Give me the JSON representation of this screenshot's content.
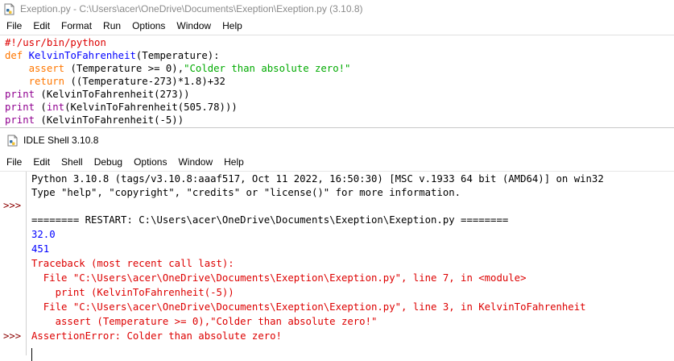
{
  "editor": {
    "title": "Exeption.py - C:\\Users\\acer\\OneDrive\\Documents\\Exeption\\Exeption.py (3.10.8)",
    "menu": [
      "File",
      "Edit",
      "Format",
      "Run",
      "Options",
      "Window",
      "Help"
    ],
    "code": {
      "l1": "#!/usr/bin/python",
      "l2_kw": "def ",
      "l2_name": "KelvinToFahrenheit",
      "l2_rest": "(Temperature):",
      "l3_indent": "    ",
      "l3_kw": "assert",
      "l3_mid": " (Temperature >= 0),",
      "l3_str": "\"Colder than absolute zero!\"",
      "l4_indent": "    ",
      "l4_kw": "return",
      "l4_rest": " ((Temperature-273)*1.8)+32",
      "l5_bi": "print",
      "l5_rest": " (KelvinToFahrenheit(273))",
      "l6_bi": "print",
      "l6_mid": " (",
      "l6_bi2": "int",
      "l6_rest": "(KelvinToFahrenheit(505.78)))",
      "l7_bi": "print",
      "l7_rest": " (KelvinToFahrenheit(-5))"
    }
  },
  "shell": {
    "title": "IDLE Shell 3.10.8",
    "menu": [
      "File",
      "Edit",
      "Shell",
      "Debug",
      "Options",
      "Window",
      "Help"
    ],
    "prompts": [
      ">>>",
      ">>>"
    ],
    "lines": {
      "banner1": "Python 3.10.8 (tags/v3.10.8:aaaf517, Oct 11 2022, 16:50:30) [MSC v.1933 64 bit (AMD64)] on win32",
      "banner2": "Type \"help\", \"copyright\", \"credits\" or \"license()\" for more information.",
      "restart": "======== RESTART: C:\\Users\\acer\\OneDrive\\Documents\\Exeption\\Exeption.py ========",
      "out1": "32.0",
      "out2": "451",
      "tb1": "Traceback (most recent call last):",
      "tb2": "  File \"C:\\Users\\acer\\OneDrive\\Documents\\Exeption\\Exeption.py\", line 7, in <module>",
      "tb3": "    print (KelvinToFahrenheit(-5))",
      "tb4": "  File \"C:\\Users\\acer\\OneDrive\\Documents\\Exeption\\Exeption.py\", line 3, in KelvinToFahrenheit",
      "tb5": "    assert (Temperature >= 0),\"Colder than absolute zero!\"",
      "tb6": "AssertionError: Colder than absolute zero!"
    }
  },
  "icons": {
    "editor_icon": "python-file-icon",
    "shell_icon": "idle-shell-icon"
  },
  "colors": {
    "keyword": "#ff7700",
    "definition": "#0000ff",
    "builtin": "#900090",
    "string": "#00aa00",
    "comment": "#dd0000",
    "stdout": "#0000ff",
    "stderr": "#dd0000",
    "prompt": "#8b0000"
  }
}
